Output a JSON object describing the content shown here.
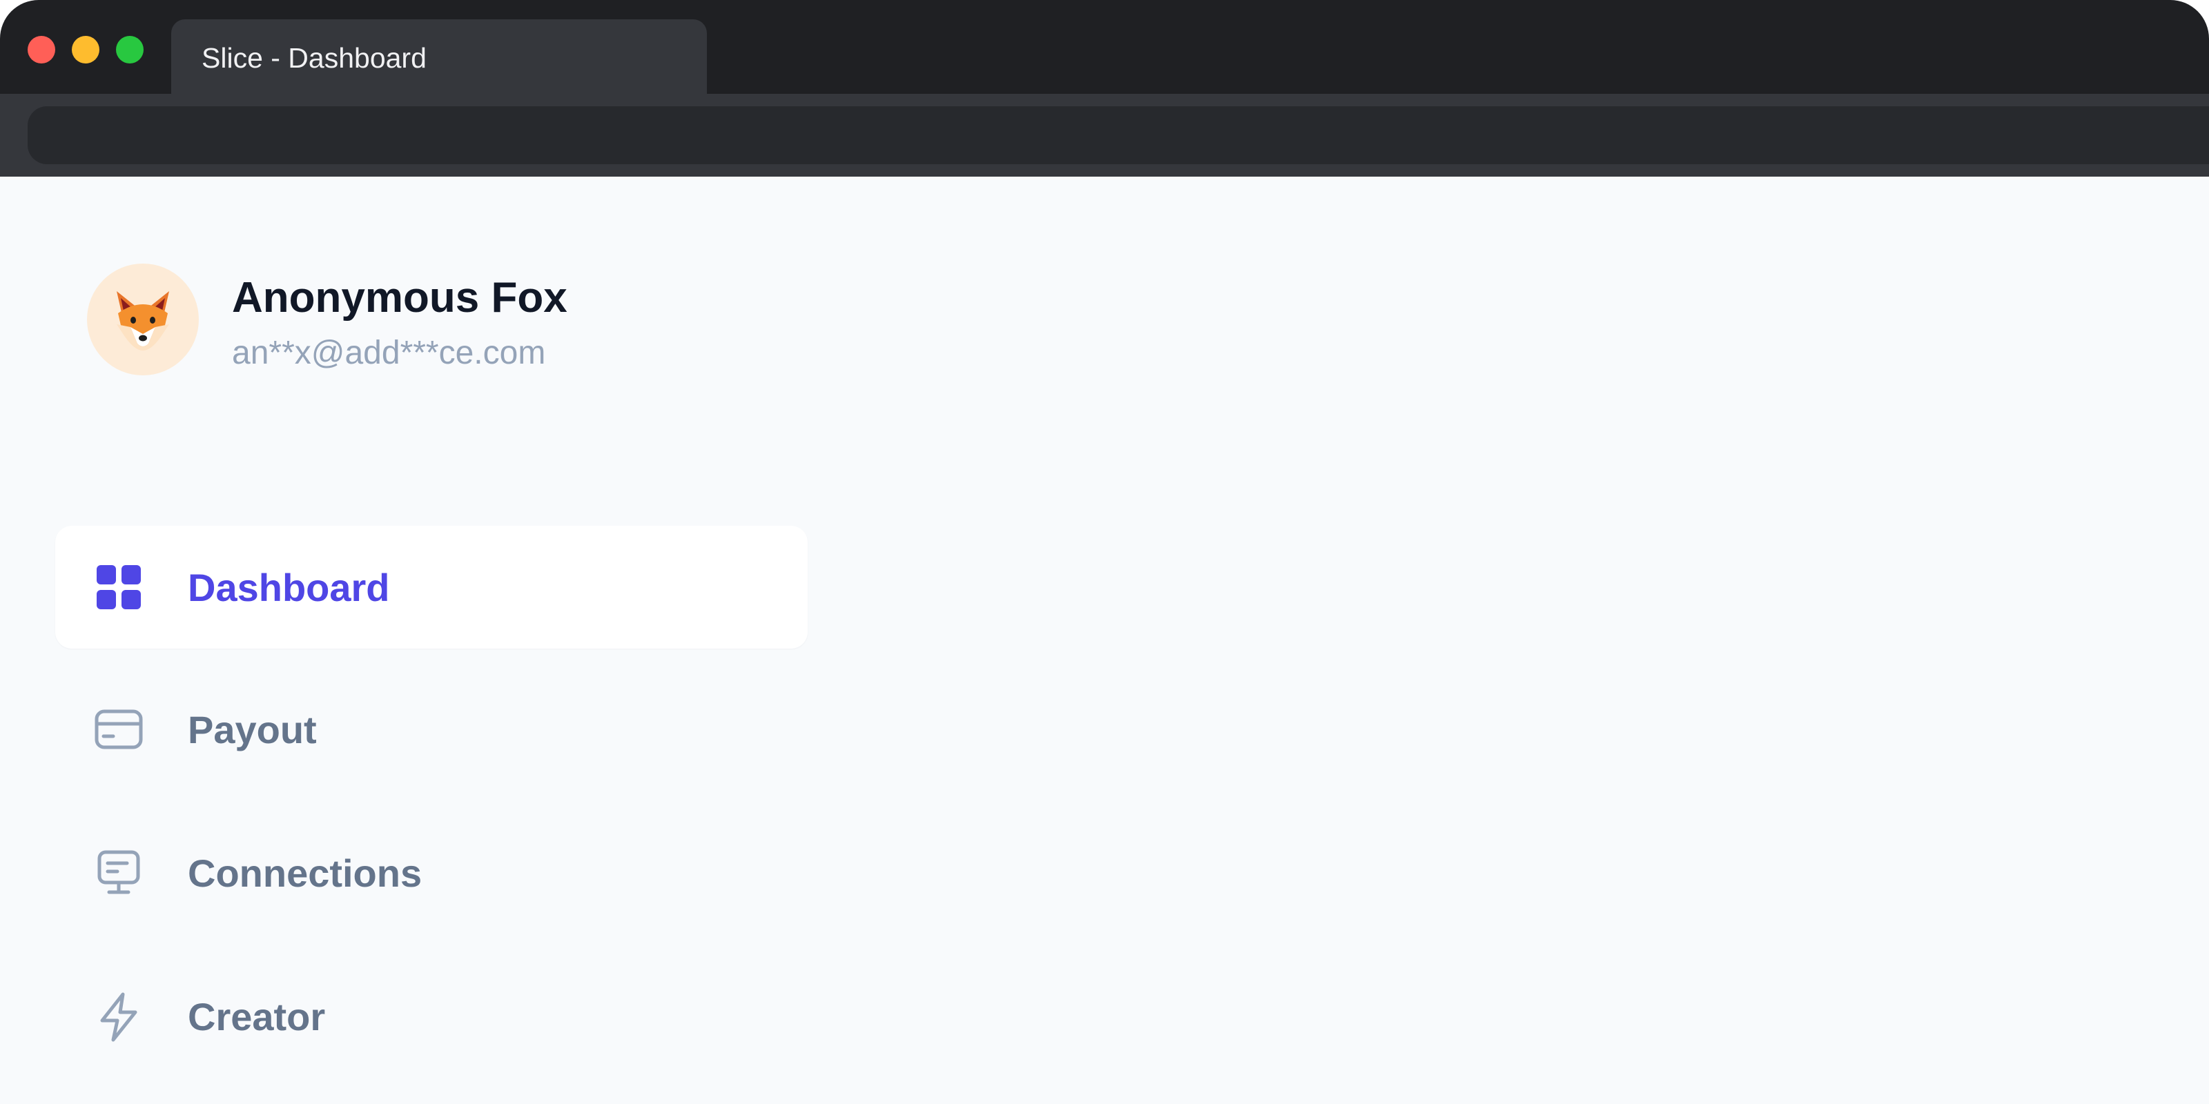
{
  "browser": {
    "tab_title": "Slice - Dashboard"
  },
  "profile": {
    "name": "Anonymous Fox",
    "email": "an**x@add***ce.com",
    "avatar_icon": "fox-face-icon"
  },
  "nav": {
    "items": [
      {
        "label": "Dashboard",
        "icon": "grid-icon",
        "active": true
      },
      {
        "label": "Payout",
        "icon": "credit-card-icon",
        "active": false
      },
      {
        "label": "Connections",
        "icon": "monitor-icon",
        "active": false
      },
      {
        "label": "Creator",
        "icon": "lightning-bolt-icon",
        "active": false
      }
    ]
  },
  "colors": {
    "accent": "#4f46e5",
    "nav_inactive": "#64748b",
    "icon_inactive": "#94a3b8",
    "background": "#f8fafc",
    "titlebar": "#1f2023"
  }
}
